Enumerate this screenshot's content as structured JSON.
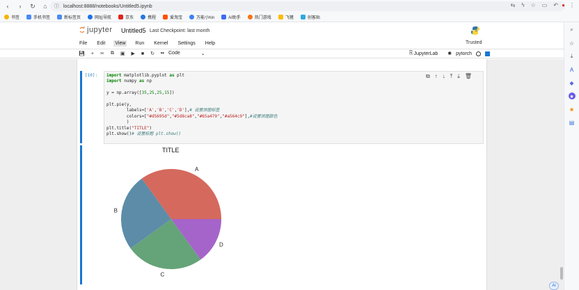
{
  "browser": {
    "url": "localhost:8888/notebooks/Untitled5.ipynb",
    "bookmarks": [
      {
        "label": "书签",
        "color": "#f5b400"
      },
      {
        "label": "手机书签",
        "color": "#4a8af4"
      },
      {
        "label": "新标签页",
        "color": "#4a8af4"
      },
      {
        "label": "网址导航",
        "color": "#1a73e8"
      },
      {
        "label": "京东",
        "color": "#e1251b"
      },
      {
        "label": "携程",
        "color": "#2577e3"
      },
      {
        "label": "爱淘宝",
        "color": "#ff5000"
      },
      {
        "label": "万能小hin",
        "color": "#3b82f6"
      },
      {
        "label": "AI助手",
        "color": "#3b6cf6"
      },
      {
        "label": "热门游戏",
        "color": "#f97316"
      },
      {
        "label": "飞猪",
        "color": "#ffbb00"
      },
      {
        "label": "创客贴",
        "color": "#2ea7e0"
      }
    ]
  },
  "jupyter": {
    "logo_text": "jupyter",
    "notebook_name": "Untitled5",
    "checkpoint": "Last Checkpoint: last month",
    "trusted": "Trusted",
    "menu": [
      "File",
      "Edit",
      "View",
      "Run",
      "Kernel",
      "Settings",
      "Help"
    ],
    "active_menu": "View",
    "cell_type": "Code",
    "jupyterlab_label": "JupyterLab",
    "kernel_name": "pytorch"
  },
  "cell": {
    "prompt": "[10]:"
  },
  "chart_data": {
    "type": "pie",
    "title": "TITLE",
    "labels": [
      "A",
      "B",
      "C",
      "D"
    ],
    "values": [
      35,
      25,
      25,
      15
    ],
    "colors": [
      "#d5695d",
      "#5d8ca8",
      "#65a479",
      "#a564c9"
    ],
    "startangle": 0,
    "direction": "counterclockwise"
  }
}
